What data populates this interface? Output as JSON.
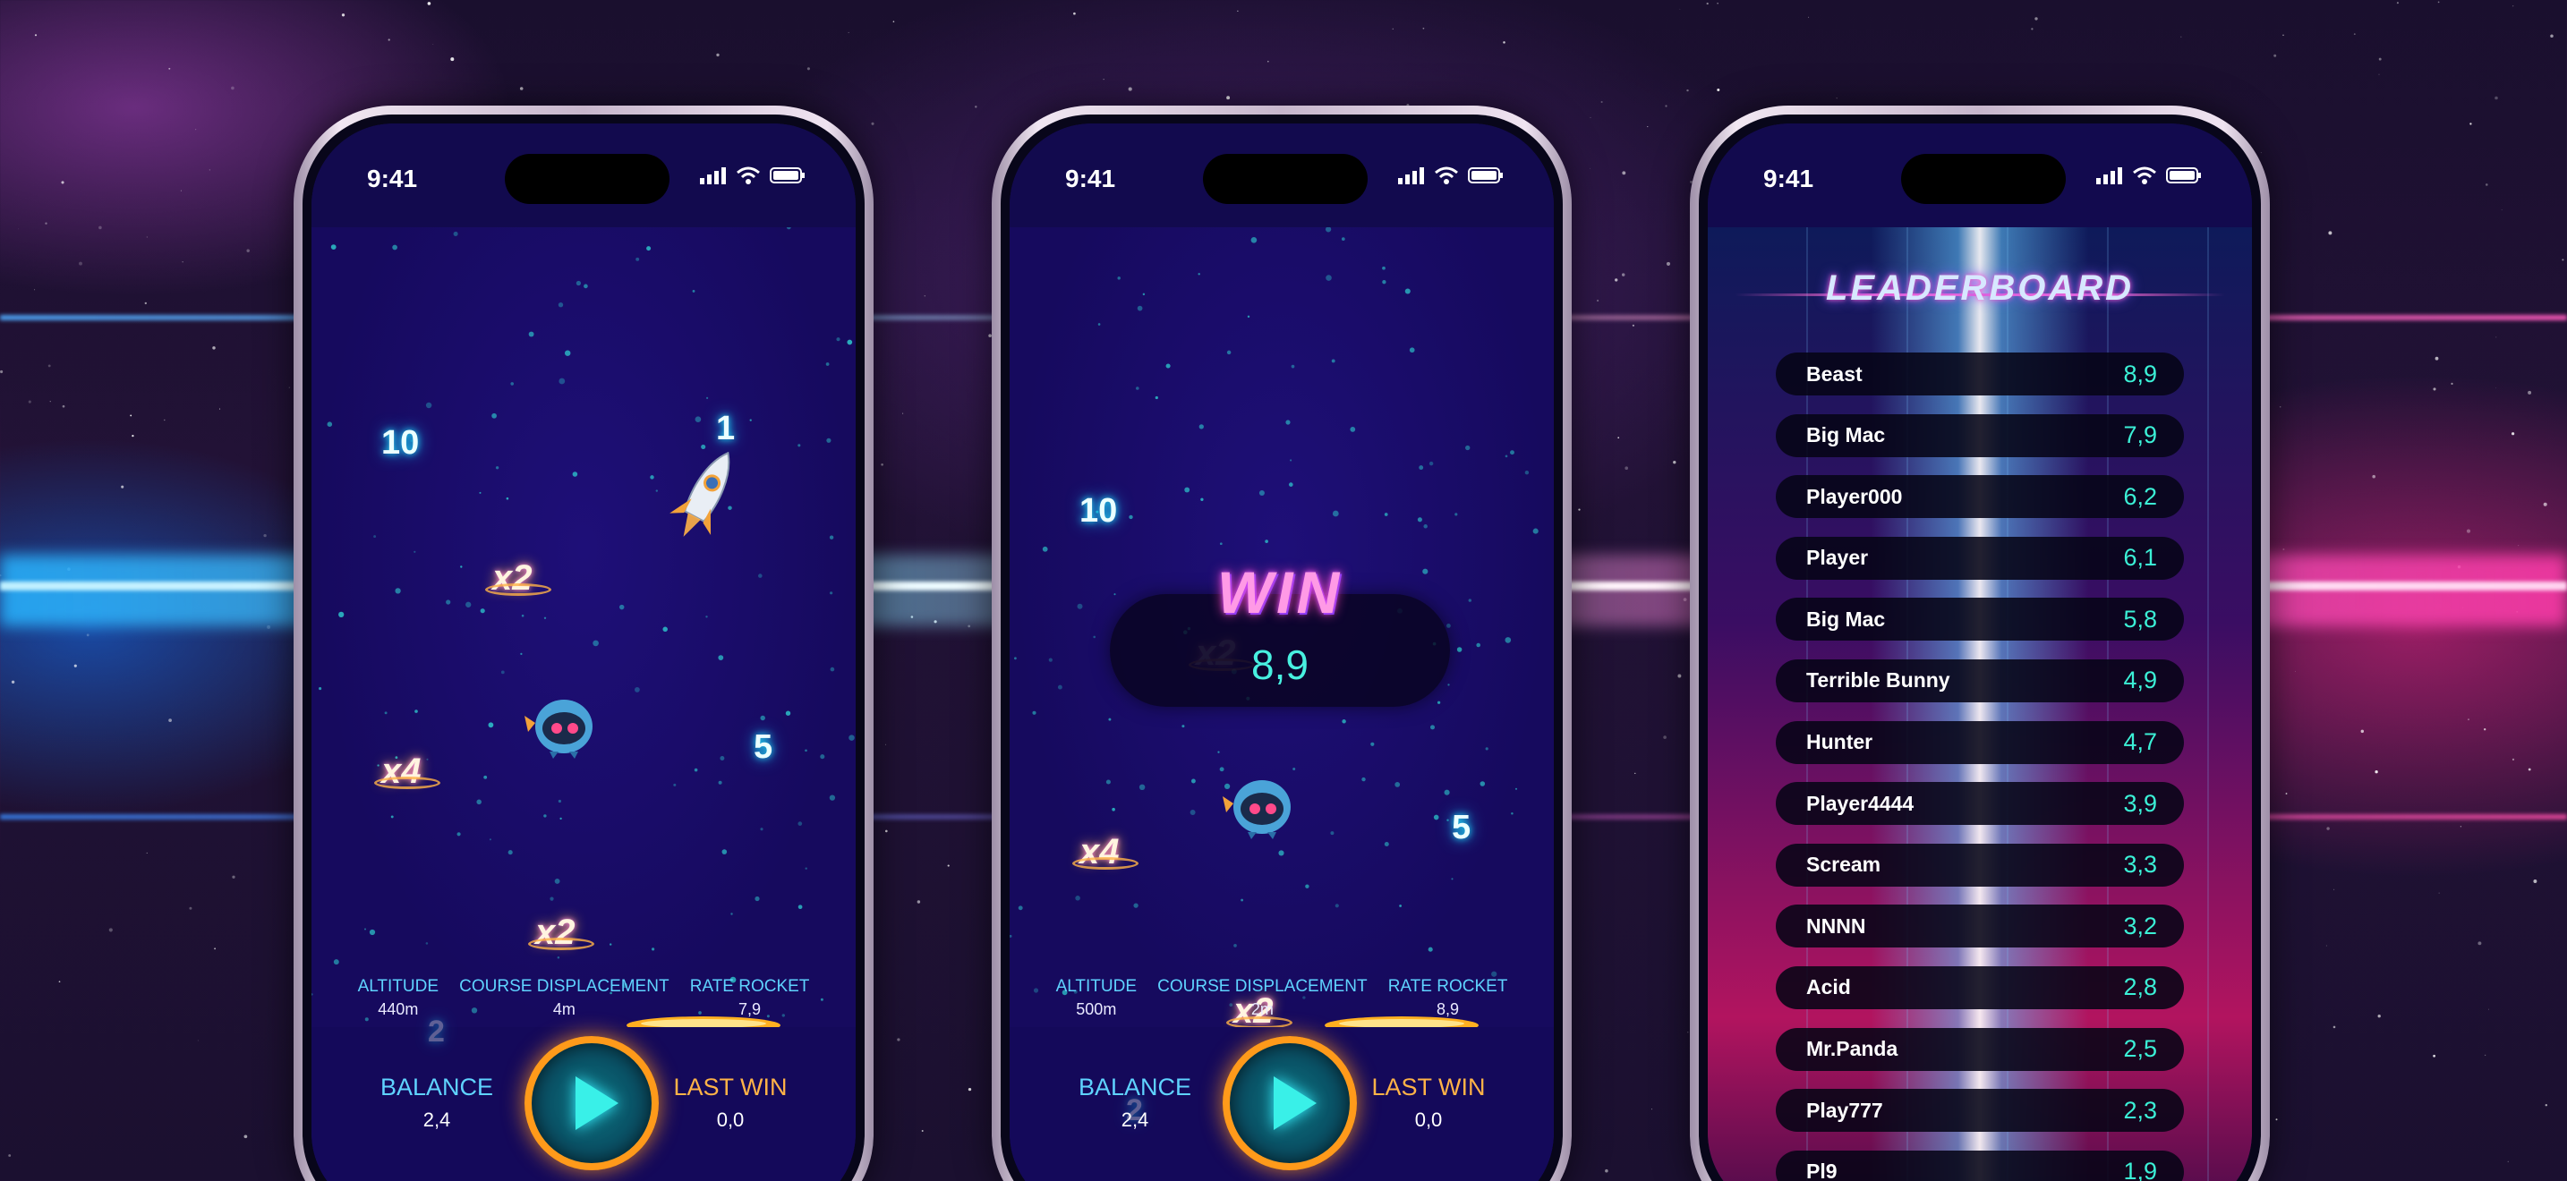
{
  "status_bar": {
    "time": "9:41"
  },
  "phone1": {
    "numbers": [
      "10",
      "1",
      "5"
    ],
    "multipliers": [
      "x2",
      "x4",
      "x2"
    ],
    "faded_number": "2",
    "stats": [
      {
        "label": "ALTITUDE",
        "value": "440m"
      },
      {
        "label": "COURSE DISPLACEMENT",
        "value": "4m"
      },
      {
        "label": "RATE ROCKET",
        "value": "7,9"
      }
    ],
    "balance": {
      "label": "BALANCE",
      "value": "2,4"
    },
    "last_win": {
      "label": "LAST WIN",
      "value": "0,0"
    }
  },
  "phone2": {
    "numbers": [
      "10",
      "5"
    ],
    "multipliers": [
      "x2",
      "x4",
      "x2"
    ],
    "faded_number": "2",
    "win": {
      "title": "WIN",
      "value": "8,9"
    },
    "stats": [
      {
        "label": "ALTITUDE",
        "value": "500m"
      },
      {
        "label": "COURSE DISPLACEMENT",
        "value": "2m"
      },
      {
        "label": "RATE ROCKET",
        "value": "8,9"
      }
    ],
    "balance": {
      "label": "BALANCE",
      "value": "2,4"
    },
    "last_win": {
      "label": "LAST WIN",
      "value": "0,0"
    }
  },
  "leaderboard": {
    "title": "LEADERBOARD",
    "rows": [
      {
        "name": "Beast",
        "score": "8,9"
      },
      {
        "name": "Big Mac",
        "score": "7,9"
      },
      {
        "name": "Player000",
        "score": "6,2"
      },
      {
        "name": "Player",
        "score": "6,1"
      },
      {
        "name": "Big Mac",
        "score": "5,8"
      },
      {
        "name": "Terrible Bunny",
        "score": "4,9"
      },
      {
        "name": "Hunter",
        "score": "4,7"
      },
      {
        "name": "Player4444",
        "score": "3,9"
      },
      {
        "name": "Scream",
        "score": "3,3"
      },
      {
        "name": "NNNN",
        "score": "3,2"
      },
      {
        "name": "Acid",
        "score": "2,8"
      },
      {
        "name": "Mr.Panda",
        "score": "2,5"
      },
      {
        "name": "Play777",
        "score": "2,3"
      },
      {
        "name": "Pl9",
        "score": "1,9"
      }
    ]
  },
  "colors": {
    "accent_cyan": "#3bf0d6",
    "accent_orange": "#ff9a1a",
    "screen_bg": "#1a0d66",
    "win_pink": "#ff9ae6"
  },
  "icons": [
    "signal-icon",
    "wifi-icon",
    "battery-icon",
    "rocket-icon",
    "alien-icon",
    "platform-icon",
    "play-icon"
  ]
}
